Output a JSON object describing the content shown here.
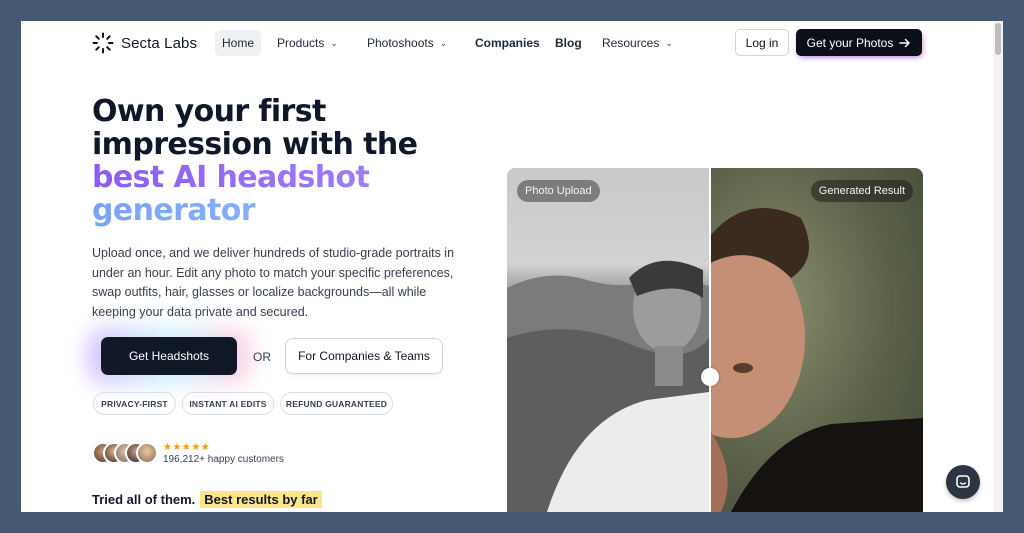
{
  "brand": {
    "name": "Secta Labs"
  },
  "nav": {
    "items": [
      {
        "label": "Home",
        "dropdown": false
      },
      {
        "label": "Products",
        "dropdown": true
      },
      {
        "label": "Photoshoots",
        "dropdown": true
      },
      {
        "label": "Companies",
        "dropdown": false
      },
      {
        "label": "Blog",
        "dropdown": false
      },
      {
        "label": "Resources",
        "dropdown": true
      }
    ],
    "login_label": "Log in",
    "cta_label": "Get your Photos"
  },
  "hero": {
    "title_line1": "Own your first",
    "title_line2": "impression with the",
    "title_line3": "best AI headshot",
    "title_line4": "generator",
    "description": "Upload once, and we deliver hundreds of studio-grade portraits in under an hour. Edit any photo to match your specific preferences, swap outfits, hair, glasses or localize backgrounds—all while keeping your data private and secured.",
    "primary_cta": "Get Headshots",
    "or_label": "OR",
    "secondary_cta": "For Companies & Teams",
    "badges": [
      "PRIVACY-FIRST",
      "INSTANT AI EDITS",
      "REFUND GUARANTEED"
    ],
    "rating_stars": "★★★★★",
    "customers_text": "196,212+ happy customers",
    "tried_text": "Tried all of them.",
    "best_text": "Best results by far"
  },
  "comparison": {
    "left_label": "Photo Upload",
    "right_label": "Generated Result"
  },
  "colors": {
    "page_bg": "#465872",
    "title_dark": "#0f172a",
    "gradient_purple": "#8b5cf6",
    "gradient_blue": "#7aa2f7",
    "cta_dark": "#101828",
    "highlight": "#fde68a"
  },
  "icons": {
    "logo": "sunburst-logo-icon",
    "arrow": "arrow-right-icon",
    "chevron": "chevron-down-icon",
    "chat": "chat-bubble-icon"
  }
}
